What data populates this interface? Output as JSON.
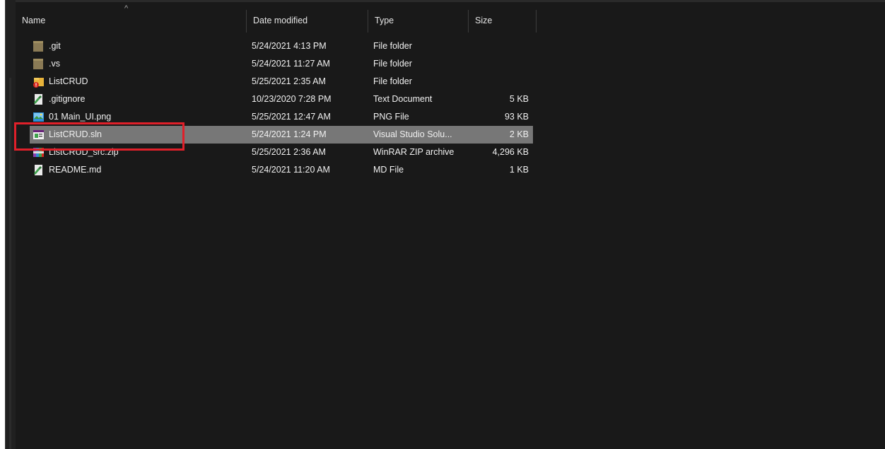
{
  "columns": {
    "name": "Name",
    "date": "Date modified",
    "type": "Type",
    "size": "Size",
    "sort_indicator": "^"
  },
  "files": [
    {
      "icon": "folder-icon",
      "name": ".git",
      "date": "5/24/2021 4:13 PM",
      "type": "File folder",
      "size": ""
    },
    {
      "icon": "folder-icon",
      "name": ".vs",
      "date": "5/24/2021 11:27 AM",
      "type": "File folder",
      "size": ""
    },
    {
      "icon": "folder-with-badge-icon",
      "name": "ListCRUD",
      "date": "5/25/2021 2:35 AM",
      "type": "File folder",
      "size": ""
    },
    {
      "icon": "text-document-icon",
      "name": ".gitignore",
      "date": "10/23/2020 7:28 PM",
      "type": "Text Document",
      "size": "5 KB"
    },
    {
      "icon": "image-file-icon",
      "name": "01 Main_UI.png",
      "date": "5/25/2021 12:47 AM",
      "type": "PNG File",
      "size": "93 KB"
    },
    {
      "icon": "visual-studio-solution-icon",
      "name": "ListCRUD.sln",
      "date": "5/24/2021 1:24 PM",
      "type": "Visual Studio Solu...",
      "size": "2 KB"
    },
    {
      "icon": "zip-archive-icon",
      "name": "ListCRUD_src.zip",
      "date": "5/25/2021 2:36 AM",
      "type": "WinRAR ZIP archive",
      "size": "4,296 KB"
    },
    {
      "icon": "markdown-file-icon",
      "name": "README.md",
      "date": "5/24/2021 11:20 AM",
      "type": "MD File",
      "size": "1 KB"
    }
  ],
  "selected_file": "ListCRUD.sln",
  "colors": {
    "background": "#191919",
    "selection": "#777777",
    "text": "#f0f0f0",
    "highlight_box": "#e0202a"
  }
}
